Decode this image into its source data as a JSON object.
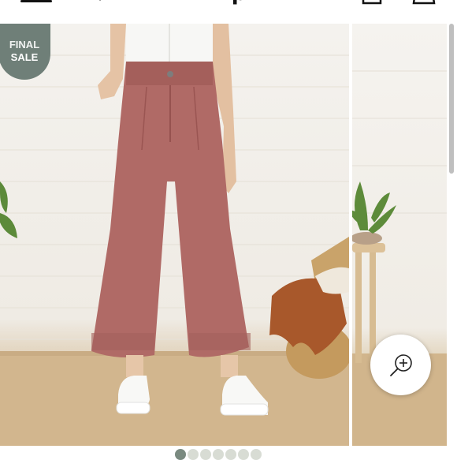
{
  "header": {
    "logo_text": "p"
  },
  "product": {
    "badge_line1": "FINAL",
    "badge_line2": "SALE",
    "pants_color": "#b06a66",
    "badge_color": "#6f7f78"
  },
  "gallery": {
    "image_count": 7,
    "active_index": 0
  },
  "icons": {
    "menu": "hamburger-menu-icon",
    "search": "search-icon",
    "account": "account-icon",
    "cart": "shopping-bag-icon",
    "zoom": "zoom-in-icon"
  }
}
